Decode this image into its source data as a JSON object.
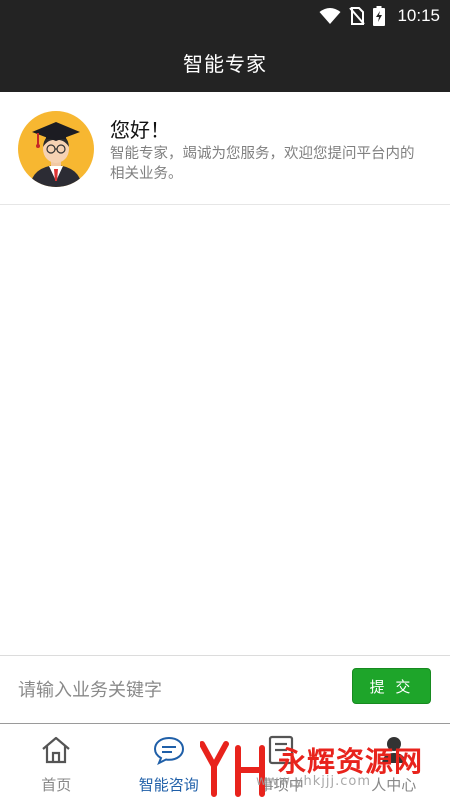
{
  "status_bar": {
    "time": "10:15",
    "icons": [
      "wifi-icon",
      "no-sim-icon",
      "battery-charging-icon"
    ]
  },
  "header": {
    "title": "智能专家"
  },
  "message": {
    "avatar_icon": "expert-graduate-avatar-icon",
    "greeting": "您好！",
    "text": "智能专家，竭诚为您服务，欢迎您提问平台内的相关业务。"
  },
  "input_bar": {
    "placeholder": "请输入业务关键字",
    "value": "",
    "submit_label": "提 交"
  },
  "tabs": [
    {
      "label": "首页",
      "icon": "home-icon",
      "active": false
    },
    {
      "label": "智能咨询",
      "icon": "chat-bubble-icon",
      "active": true
    },
    {
      "label": "事项中",
      "icon": "document-icon",
      "active": false
    },
    {
      "label": "人中心",
      "icon": "person-icon",
      "active": false
    }
  ],
  "watermark": {
    "logo_text": "YH",
    "text": "永辉资源网",
    "url": "www.yhkjjj.com"
  },
  "colors": {
    "header_bg": "#232323",
    "accent_green": "#1ea52a",
    "active_tab": "#1f5fa8",
    "avatar_bg": "#f7b731",
    "watermark_red": "#e8231c"
  }
}
